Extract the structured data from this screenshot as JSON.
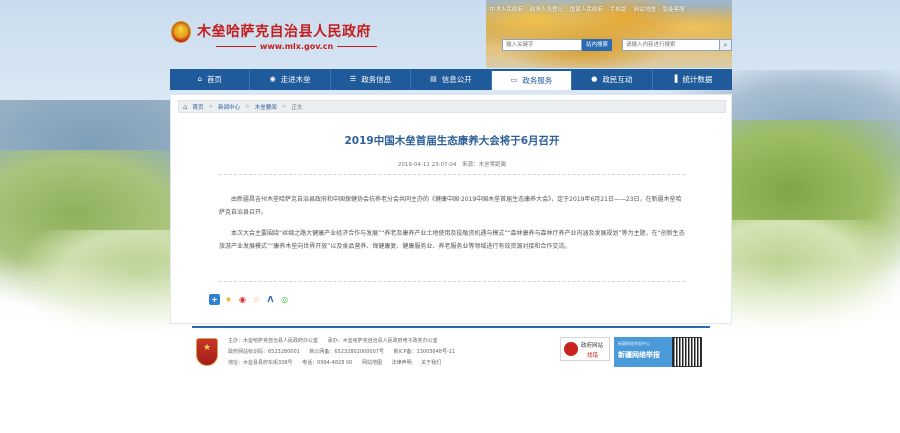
{
  "header": {
    "site_title": "木垒哈萨克自治县人民政府",
    "site_url": "www.mlx.gov.cn",
    "top_links": [
      "中木人民政府",
      "政务人员登记",
      "国家人民政府",
      "手机版",
      "网站地图",
      "智能客服"
    ],
    "search_placeholder": "输入关键字",
    "search_button": "站内搜索",
    "search2_placeholder": "请输入内容进行搜索"
  },
  "nav": [
    {
      "label": "首页",
      "icon": "home-icon"
    },
    {
      "label": "走进木垒",
      "icon": "camera-icon"
    },
    {
      "label": "政务信息",
      "icon": "list-icon"
    },
    {
      "label": "信息公开",
      "icon": "document-icon"
    },
    {
      "label": "政务服务",
      "icon": "monitor-icon",
      "active": true
    },
    {
      "label": "政民互动",
      "icon": "chat-icon"
    },
    {
      "label": "统计数据",
      "icon": "chart-icon"
    }
  ],
  "breadcrumb": {
    "items": [
      "首页",
      "新闻中心",
      "木垒要闻",
      "正文"
    ]
  },
  "article": {
    "title": "2019中国木垒首届生态康养大会将于6月召开",
    "date": "2019-04-11 23:07:04",
    "source": "来源：木垒零距离",
    "paragraph1": "由新疆昌吉州木垒哈萨克自治县政府和中国保健协会抗养老分会共同主办的《健康中国·2019中国木垒首届生态康养大会》，定于2019年6月21日——23日，在新疆木垒哈萨克自治县召开。",
    "paragraph2": "本次大会主要围绕“丝绸之路大健康产业经济合作与发展”“养老及康养产业土地使用及投融资机遇与模式”“森林康养与森林疗养产业内涵及发展规划”等为主题，在“创新生态旅游产业发展模式”“康养木垒向世界开放”以及食品营养、保健康复、健康服务业、养老服务业等领域进行有效资源对接和合作交流。"
  },
  "share_icons": [
    "plus-share-icon",
    "favorite-icon",
    "weibo-icon",
    "qzone-icon",
    "renren-icon",
    "wechat-icon"
  ],
  "footer": {
    "line1": "主办：木垒哈萨克自治县人民政府办公室",
    "line1b": "承办：木垒哈萨克自治县人民政府电子政务办公室",
    "line2": "政府网站标识码：6523280001",
    "line2b": "新公网备：65232802000007号",
    "line2c": "新ICP备：13003648号-11",
    "line3": "地址：木垒县县府东街338号",
    "line3b": "电话：0994-4828 00",
    "line3c": "网站地图",
    "line3d": "法律声明",
    "line3e": "关于我们",
    "gov_badge_top": "政府网站",
    "gov_badge_bottom": "找错",
    "report_top": "新疆网络举报中心",
    "report_main": "新疆网络举报"
  }
}
